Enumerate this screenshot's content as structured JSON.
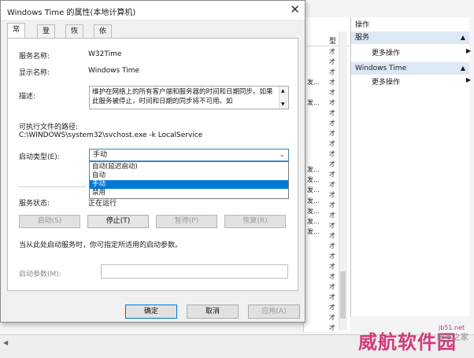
{
  "background": {
    "list_header": [
      "型"
    ],
    "list_rows": [
      "才",
      "才",
      "才",
      "才",
      "才",
      "才",
      "才",
      "才",
      "才",
      "才",
      "才",
      "才",
      "才",
      "才",
      "才",
      "才",
      "才",
      "才",
      "才",
      "才",
      "才",
      "才",
      "才",
      "才",
      "才",
      "才",
      "才",
      "才"
    ],
    "col_hint": [
      "发...",
      "发...",
      "发...",
      "发...",
      "发...",
      "发...",
      "发...",
      "发...",
      "发..."
    ],
    "actions": {
      "header": "操作",
      "group1": "服务",
      "item1": "更多操作",
      "group2": "Windows Time",
      "item2": "更多操作"
    },
    "watermark": "威航软件园",
    "watermark2": "脚本之家",
    "watermark_url": "jb51.net"
  },
  "dialog": {
    "title": "Windows Time 的属性(本地计算机)",
    "tabs": [
      "常规",
      "登录",
      "恢复",
      "依存关系"
    ],
    "service_name_label": "服务名称:",
    "service_name": "W32Time",
    "display_name_label": "显示名称:",
    "display_name": "Windows Time",
    "description_label": "描述:",
    "description": "维护在网络上的所有客户端和服务器的时间和日期同步。如果此服务被停止，时间和日期的同步将不可用。如",
    "exe_path_label": "可执行文件的路径:",
    "exe_path": "C:\\WINDOWS\\system32\\svchost.exe -k LocalService",
    "startup_type_label": "启动类型(E):",
    "startup_type_value": "手动",
    "startup_options": [
      "自动(延迟启动)",
      "自动",
      "手动",
      "禁用"
    ],
    "startup_selected_index": 2,
    "status_label": "服务状态:",
    "status_value": "正在运行",
    "buttons": {
      "start": "启动(S)",
      "stop": "停止(T)",
      "pause": "暂停(P)",
      "resume": "恢复(R)"
    },
    "params_hint": "当从此处启动服务时，你可指定所适用的启动参数。",
    "params_label": "启动参数(M):",
    "params_value": "",
    "footer": {
      "ok": "确定",
      "cancel": "取消",
      "apply": "应用(A)"
    }
  }
}
